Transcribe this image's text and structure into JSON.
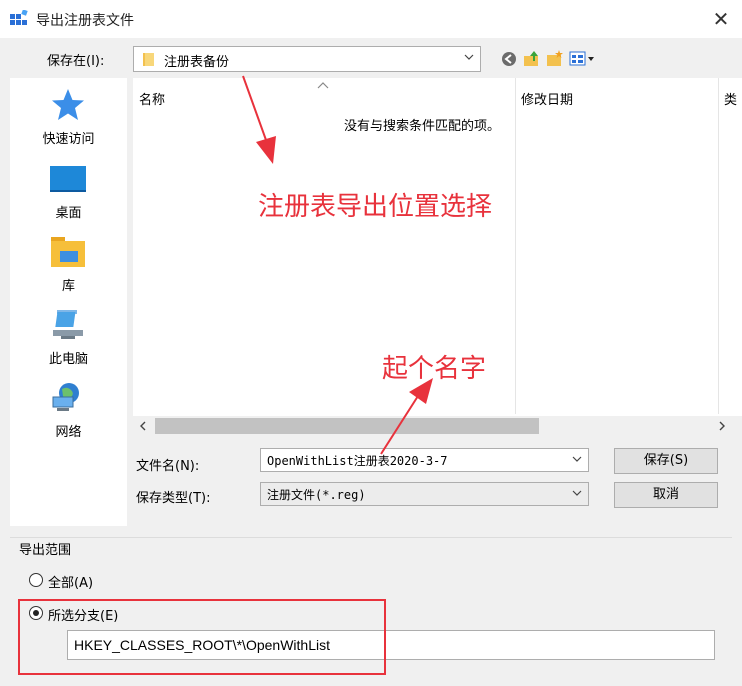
{
  "window": {
    "title": "导出注册表文件"
  },
  "save_in": {
    "label": "保存在(I):",
    "value": "注册表备份"
  },
  "places": [
    {
      "label": "快速访问"
    },
    {
      "label": "桌面"
    },
    {
      "label": "库"
    },
    {
      "label": "此电脑"
    },
    {
      "label": "网络"
    }
  ],
  "file_list": {
    "columns": [
      "名称",
      "修改日期",
      "类"
    ],
    "empty_message": "没有与搜索条件匹配的项。"
  },
  "file_name": {
    "label": "文件名(N):",
    "value": "OpenWithList注册表2020-3-7"
  },
  "file_type": {
    "label": "保存类型(T):",
    "value": "注册文件(*.reg)"
  },
  "buttons": {
    "save": "保存(S)",
    "cancel": "取消"
  },
  "export_range": {
    "group_label": "导出范围",
    "all_label": "全部(A)",
    "selected_label": "所选分支(E)",
    "branch_value": "HKEY_CLASSES_ROOT\\*\\OpenWithList",
    "selected": "selected_branch"
  },
  "annotations": {
    "location": "注册表导出位置选择",
    "name": "起个名字",
    "color": "#e8323c"
  }
}
